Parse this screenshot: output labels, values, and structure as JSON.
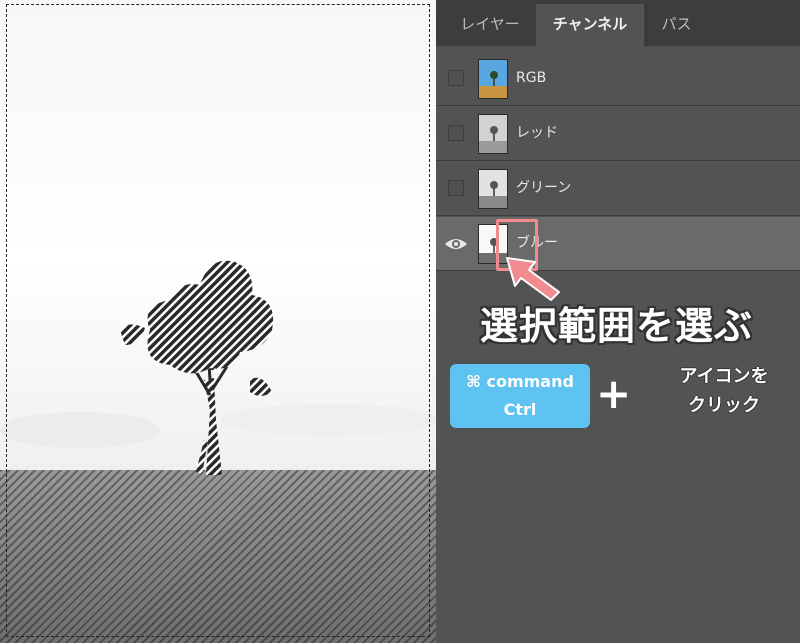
{
  "panel": {
    "tabs": [
      {
        "label": "レイヤー"
      },
      {
        "label": "チャンネル"
      },
      {
        "label": "パス"
      }
    ],
    "channels": [
      {
        "name": "RGB",
        "visible": false
      },
      {
        "name": "レッド",
        "visible": false
      },
      {
        "name": "グリーン",
        "visible": false
      },
      {
        "name": "ブルー",
        "visible": true
      }
    ]
  },
  "annotation": {
    "title": "選択範囲を選ぶ",
    "key_mac": "⌘ command",
    "key_win": "Ctrl",
    "plus": "+",
    "action_line1": "アイコンを",
    "action_line2": "クリック"
  },
  "colors": {
    "accent_highlight": "#f28b8f",
    "key_badge": "#5ec3f1",
    "panel_bg": "#535353",
    "active_row": "#6a6a6a"
  }
}
